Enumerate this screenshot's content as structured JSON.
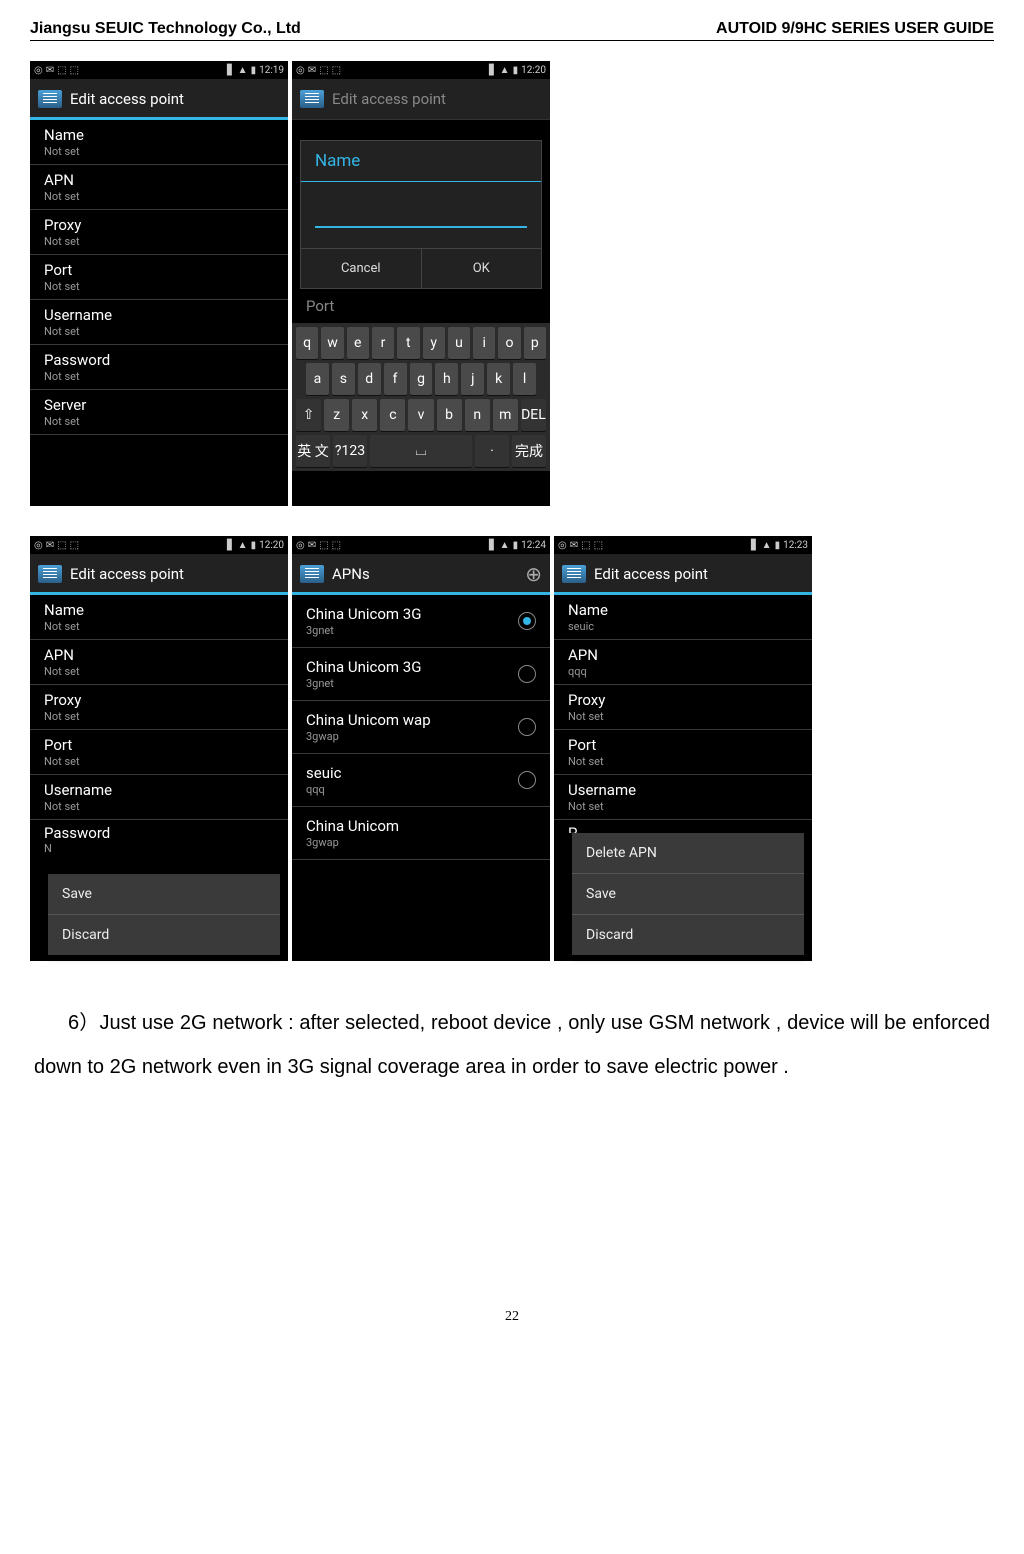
{
  "header": {
    "left": "Jiangsu SEUIC Technology Co., Ltd",
    "right": "AUTOID 9/9HC SERIES USER GUIDE"
  },
  "times": {
    "t1219": "12:19",
    "t1220": "12:20",
    "t1220b": "12:20",
    "t1224": "12:24",
    "t1223": "12:23"
  },
  "titles": {
    "edit": "Edit access point",
    "apns": "APNs"
  },
  "dialog": {
    "title": "Name",
    "cancel": "Cancel",
    "ok": "OK",
    "below": "Port"
  },
  "fields": {
    "name": "Name",
    "apn": "APN",
    "proxy": "Proxy",
    "port": "Port",
    "user": "Username",
    "pass": "Password",
    "server": "Server",
    "notset": "Not set",
    "seuic": "seuic",
    "qqq": "qqq"
  },
  "apns": {
    "cu3g": "China Unicom 3G",
    "net": "3gnet",
    "cuwap": "China Unicom wap",
    "wap": "3gwap",
    "seuic": "seuic",
    "q": "qqq",
    "cu": "China Unicom"
  },
  "popup": {
    "delete": "Delete APN",
    "save": "Save",
    "discard": "Discard"
  },
  "keys": {
    "r1": [
      "q",
      "w",
      "e",
      "r",
      "t",
      "y",
      "u",
      "i",
      "o",
      "p"
    ],
    "r2": [
      "a",
      "s",
      "d",
      "f",
      "g",
      "h",
      "j",
      "k",
      "l"
    ],
    "r3shift": "⇧",
    "r3": [
      "z",
      "x",
      "c",
      "v",
      "b",
      "n",
      "m"
    ],
    "r3del": "DEL",
    "r4a": "英 文",
    "r4b": "?123",
    "r4dot": "·",
    "r4done": "完成"
  },
  "body": {
    "p1": "6）Just use 2G network : after selected, reboot device , only use GSM network , device will be enforced down to 2G network even in 3G signal coverage area in order to save electric power ."
  },
  "pagenum": "22"
}
